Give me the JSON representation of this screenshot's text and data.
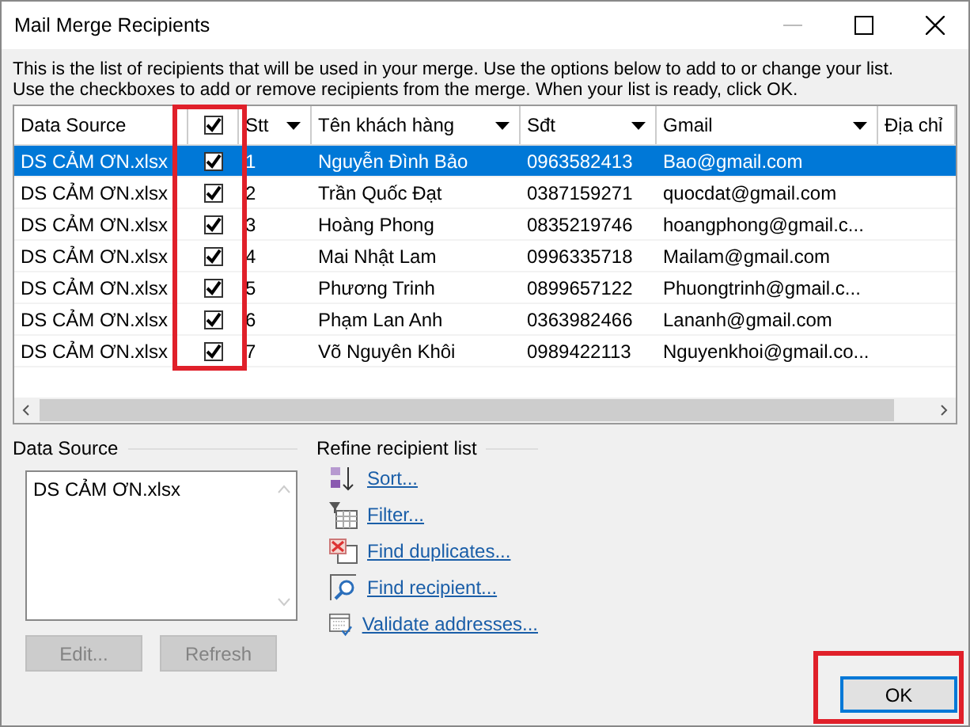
{
  "window": {
    "title": "Mail Merge Recipients"
  },
  "intro": [
    "This is the list of recipients that will be used in your merge.  Use the options below to add to or change your list.",
    "Use the checkboxes to add or remove recipients from the merge.  When your list is ready, click OK."
  ],
  "table": {
    "select_all_checked": true,
    "columns": [
      {
        "label": "Data Source",
        "dropdown": false
      },
      {
        "label": "Stt",
        "dropdown": true
      },
      {
        "label": "Tên khách hàng",
        "dropdown": true
      },
      {
        "label": "Sđt",
        "dropdown": true
      },
      {
        "label": "Gmail",
        "dropdown": true
      },
      {
        "label": "Địa chỉ",
        "dropdown": false
      }
    ],
    "rows": [
      {
        "checked": true,
        "selected": true,
        "cells": [
          "DS CẢM ƠN.xlsx",
          "1",
          "Nguyễn Đình Bảo",
          "0963582413",
          "Bao@gmail.com"
        ]
      },
      {
        "checked": true,
        "selected": false,
        "cells": [
          "DS CẢM ƠN.xlsx",
          "2",
          "Trần Quốc Đạt",
          "0387159271",
          "quocdat@gmail.com"
        ]
      },
      {
        "checked": true,
        "selected": false,
        "cells": [
          "DS CẢM ƠN.xlsx",
          "3",
          "Hoàng Phong",
          "0835219746",
          "hoangphong@gmail.c..."
        ]
      },
      {
        "checked": true,
        "selected": false,
        "cells": [
          "DS CẢM ƠN.xlsx",
          "4",
          "Mai Nhật Lam",
          "0996335718",
          "Mailam@gmail.com"
        ]
      },
      {
        "checked": true,
        "selected": false,
        "cells": [
          "DS CẢM ƠN.xlsx",
          "5",
          "Phương Trinh",
          "0899657122",
          "Phuongtrinh@gmail.c..."
        ]
      },
      {
        "checked": true,
        "selected": false,
        "cells": [
          "DS CẢM ƠN.xlsx",
          "6",
          "Phạm Lan Anh",
          "0363982466",
          "Lananh@gmail.com"
        ]
      },
      {
        "checked": true,
        "selected": false,
        "cells": [
          "DS CẢM ƠN.xlsx",
          "7",
          "Võ Nguyên Khôi",
          "0989422113",
          "Nguyenkhoi@gmail.co..."
        ]
      }
    ]
  },
  "data_source": {
    "label": "Data Source",
    "items": [
      "DS CẢM ƠN.xlsx"
    ],
    "buttons": [
      {
        "label": "Edit...",
        "disabled": true
      },
      {
        "label": "Refresh",
        "disabled": true
      }
    ]
  },
  "refine": {
    "label": "Refine recipient list",
    "links": [
      {
        "label": "Sort...",
        "kind": "sort"
      },
      {
        "label": "Filter...",
        "kind": "filter"
      },
      {
        "label": "Find duplicates...",
        "kind": "duplicates"
      },
      {
        "label": "Find recipient...",
        "kind": "find"
      },
      {
        "label": "Validate addresses...",
        "kind": "validate"
      }
    ]
  },
  "ok_button": {
    "label": "OK"
  }
}
